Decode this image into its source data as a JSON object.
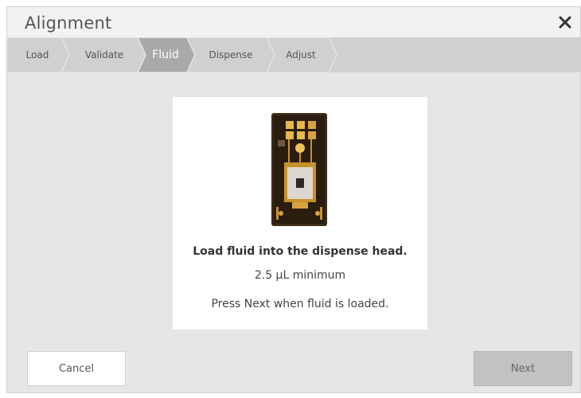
{
  "dialog": {
    "title": "Alignment",
    "close_icon": "close-icon"
  },
  "steps": [
    {
      "label": "Load",
      "active": false
    },
    {
      "label": "Validate",
      "active": false
    },
    {
      "label": "Fluid",
      "active": true
    },
    {
      "label": "Dispense",
      "active": false
    },
    {
      "label": "Adjust",
      "active": false
    }
  ],
  "content": {
    "image": "dispense-head-chip-image",
    "headline": "Load fluid into the dispense head.",
    "subline": "2.5 µL minimum",
    "hint": "Press Next when fluid is loaded."
  },
  "footer": {
    "cancel_label": "Cancel",
    "next_label": "Next"
  },
  "colors": {
    "active_step": "#a9a9a9",
    "step_bar": "#d0d0d0",
    "background": "#e6e6e6"
  }
}
